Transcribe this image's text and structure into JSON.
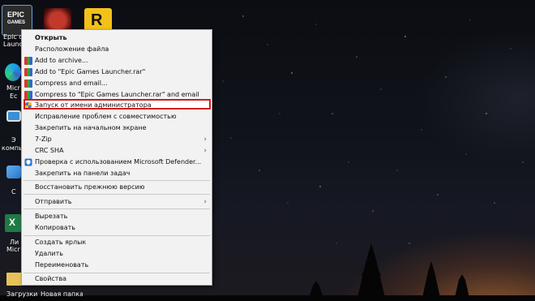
{
  "desktop": {
    "icons": [
      {
        "label": "Epic Games Launcher",
        "label_visible": "Epic c"
      },
      {
        "label": "Launc..."
      },
      {
        "label": "Micr"
      },
      {
        "label": "Ec"
      },
      {
        "label": "Э"
      },
      {
        "label": "компь"
      },
      {
        "label": "C"
      },
      {
        "label": "Ли"
      },
      {
        "label": "Micr"
      },
      {
        "label": "Загрузки"
      },
      {
        "label": "Новая папка"
      }
    ],
    "epic_logo_text": "EPIC",
    "epic_logo_sub": "GAMES"
  },
  "context_menu": {
    "items": [
      {
        "label": "Открыть",
        "bold": true,
        "icon": "none"
      },
      {
        "label": "Расположение файла",
        "icon": "none"
      },
      {
        "label": "Add to archive...",
        "icon": "winrar-icon"
      },
      {
        "label": "Add to \"Epic Games Launcher.rar\"",
        "icon": "winrar-icon"
      },
      {
        "label": "Compress and email...",
        "icon": "winrar-icon"
      },
      {
        "label": "Compress to \"Epic Games Launcher.rar\" and email",
        "icon": "winrar-icon"
      },
      {
        "label": "Запуск от имени администратора",
        "icon": "uac-shield-icon",
        "highlighted": true
      },
      {
        "label": "Исправление проблем с совместимостью",
        "icon": "none"
      },
      {
        "label": "Закрепить на начальном экране",
        "icon": "none"
      },
      {
        "label": "7-Zip",
        "icon": "none",
        "submenu": true
      },
      {
        "label": "CRC SHA",
        "icon": "none",
        "submenu": true
      },
      {
        "label": "Проверка с использованием Microsoft Defender...",
        "icon": "defender-icon"
      },
      {
        "label": "Закрепить на панели задач",
        "icon": "none"
      },
      {
        "label": "Восстановить прежнюю версию",
        "icon": "none"
      },
      {
        "label": "Отправить",
        "icon": "none",
        "submenu": true
      },
      {
        "label": "Вырезать",
        "icon": "none"
      },
      {
        "label": "Копировать",
        "icon": "none"
      },
      {
        "label": "Создать ярлык",
        "icon": "none"
      },
      {
        "label": "Удалить",
        "icon": "none"
      },
      {
        "label": "Переименовать",
        "icon": "none"
      },
      {
        "label": "Свойства",
        "icon": "none"
      }
    ],
    "submenu_arrow": "›"
  },
  "colors": {
    "highlight_border": "#d31b1b",
    "menu_bg": "#f2f2f2"
  }
}
